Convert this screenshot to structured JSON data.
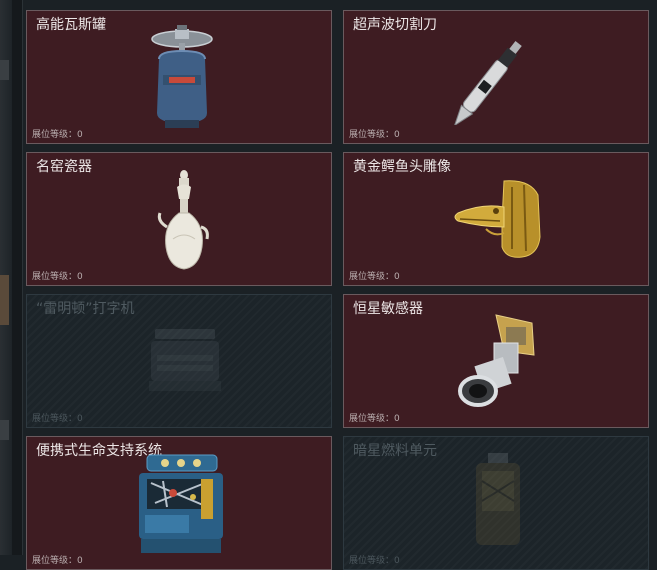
{
  "cards": [
    {
      "title": "高能瓦斯罐",
      "level_label": "展位等级：0",
      "icon": "gas-canister-icon",
      "state": "unlocked"
    },
    {
      "title": "超声波切割刀",
      "level_label": "展位等级：0",
      "icon": "ultrasonic-knife-icon",
      "state": "unlocked"
    },
    {
      "title": "名窑瓷器",
      "level_label": "展位等级：0",
      "icon": "porcelain-vase-icon",
      "state": "unlocked"
    },
    {
      "title": "黄金鳄鱼头雕像",
      "level_label": "展位等级：0",
      "icon": "golden-crocodile-head-icon",
      "state": "unlocked"
    },
    {
      "title": "“雷明顿”打字机",
      "level_label": "展位等级：0",
      "icon": "typewriter-icon",
      "state": "locked"
    },
    {
      "title": "恒星敏感器",
      "level_label": "展位等级：0",
      "icon": "star-sensor-icon",
      "state": "unlocked"
    },
    {
      "title": "便携式生命支持系统",
      "level_label": "展位等级：0",
      "icon": "life-support-system-icon",
      "state": "unlocked"
    },
    {
      "title": "暗星燃料单元",
      "level_label": "展位等级：0",
      "icon": "fuel-cell-icon",
      "state": "locked"
    }
  ],
  "colors": {
    "card_unlocked_bg": "#3e1c22",
    "card_locked_bg": "#1c2429",
    "page_bg": "#1b2125"
  }
}
